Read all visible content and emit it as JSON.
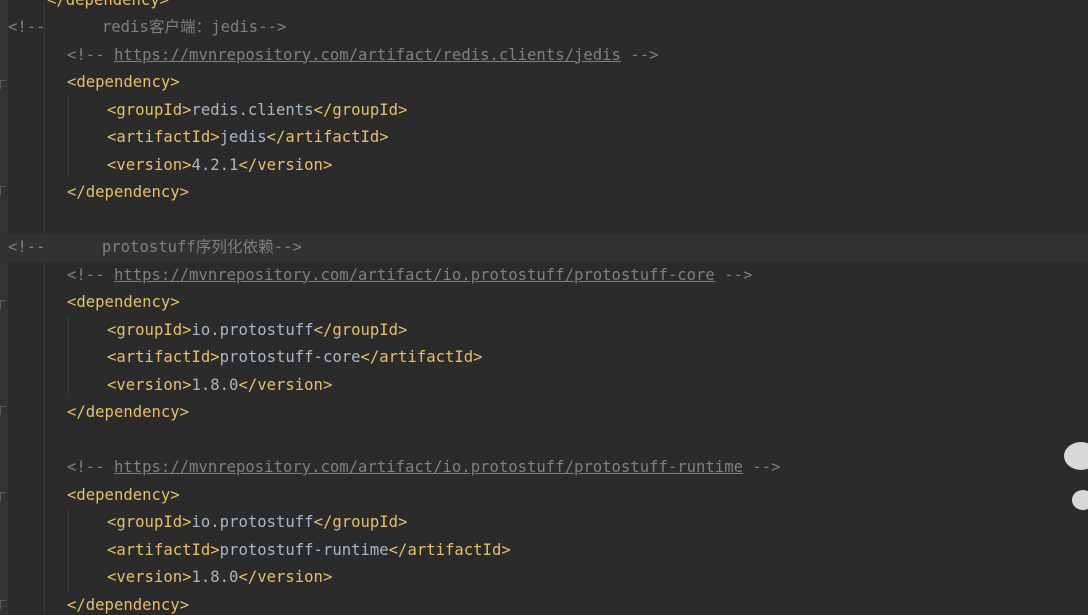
{
  "editor": {
    "lines": [
      {
        "kind": "tag",
        "text": "</dependency>"
      },
      {
        "kind": "section",
        "prefix": "<!--",
        "text": "      redis客户端：jedis-->"
      },
      {
        "kind": "url",
        "open": "<!-- ",
        "url": "https://mvnrepository.com/artifact/redis.clients/jedis",
        "close": " -->"
      },
      {
        "kind": "tag",
        "text": "<dependency>"
      },
      {
        "kind": "elem",
        "open": "<groupId>",
        "value": "redis.clients",
        "close": "</groupId>"
      },
      {
        "kind": "elem",
        "open": "<artifactId>",
        "value": "jedis",
        "close": "</artifactId>"
      },
      {
        "kind": "elem",
        "open": "<version>",
        "value": "4.2.1",
        "close": "</version>"
      },
      {
        "kind": "tag",
        "text": "</dependency>"
      },
      {
        "kind": "blank"
      },
      {
        "kind": "section",
        "prefix": "<!--",
        "text": "      protostuff序列化依赖-->"
      },
      {
        "kind": "url",
        "open": "<!-- ",
        "url": "https://mvnrepository.com/artifact/io.protostuff/protostuff-core",
        "close": " -->"
      },
      {
        "kind": "tag",
        "text": "<dependency>"
      },
      {
        "kind": "elem",
        "open": "<groupId>",
        "value": "io.protostuff",
        "close": "</groupId>"
      },
      {
        "kind": "elem",
        "open": "<artifactId>",
        "value": "protostuff-core",
        "close": "</artifactId>"
      },
      {
        "kind": "elem",
        "open": "<version>",
        "value": "1.8.0",
        "close": "</version>"
      },
      {
        "kind": "tag",
        "text": "</dependency>"
      },
      {
        "kind": "blank"
      },
      {
        "kind": "url",
        "open": "<!-- ",
        "url": "https://mvnrepository.com/artifact/io.protostuff/protostuff-runtime",
        "close": " -->"
      },
      {
        "kind": "tag",
        "text": "<dependency>"
      },
      {
        "kind": "elem",
        "open": "<groupId>",
        "value": "io.protostuff",
        "close": "</groupId>"
      },
      {
        "kind": "elem",
        "open": "<artifactId>",
        "value": "protostuff-runtime",
        "close": "</artifactId>"
      },
      {
        "kind": "elem",
        "open": "<version>",
        "value": "1.8.0",
        "close": "</version>"
      },
      {
        "kind": "tag",
        "text": "</dependency>"
      }
    ],
    "colors": {
      "background": "#2b2b2b",
      "comment": "#808080",
      "tag": "#e8bf6a",
      "text": "#a9b7c6"
    }
  }
}
